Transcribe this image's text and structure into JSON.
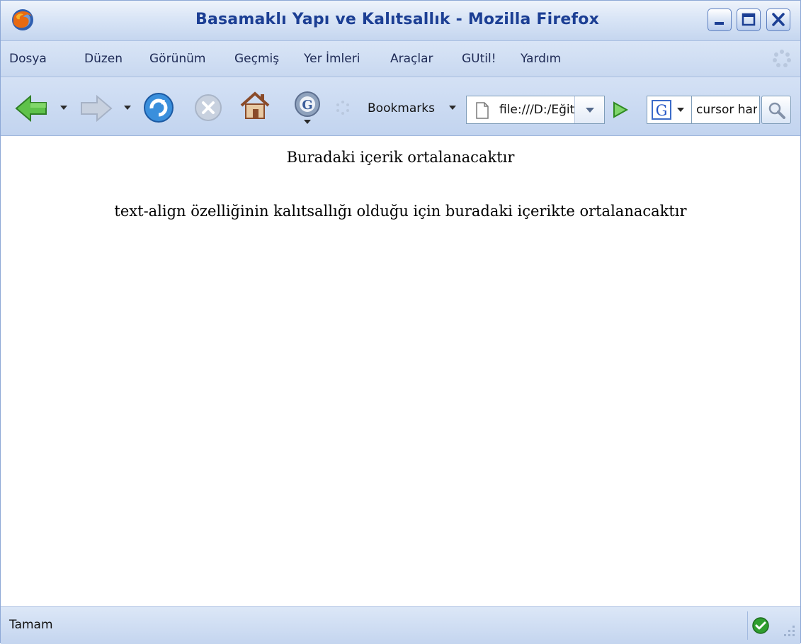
{
  "window": {
    "title": "Basamaklı Yapı ve Kalıtsallık - Mozilla Firefox"
  },
  "menu": {
    "items": [
      "Dosya",
      "Düzen",
      "Görünüm",
      "Geçmiş",
      "Yer İmleri",
      "Araçlar",
      "GUtil!",
      "Yardım"
    ]
  },
  "toolbar": {
    "bookmarks_label": "Bookmarks",
    "url_value": "file:///D:/Eğitim/CSS/basamak.html",
    "search_value": "cursor hand",
    "search_engine_icon": "google-icon"
  },
  "page": {
    "paragraph1": "Buradaki içerik ortalanacaktır",
    "paragraph2": "text-align özelliğinin kalıtsallığı olduğu için buradaki içerikte ortalanacaktır"
  },
  "status": {
    "text": "Tamam"
  },
  "colors": {
    "title_text": "#1c3f94",
    "chrome_light": "#d9e5f6",
    "chrome_dark": "#c2d4ef"
  }
}
